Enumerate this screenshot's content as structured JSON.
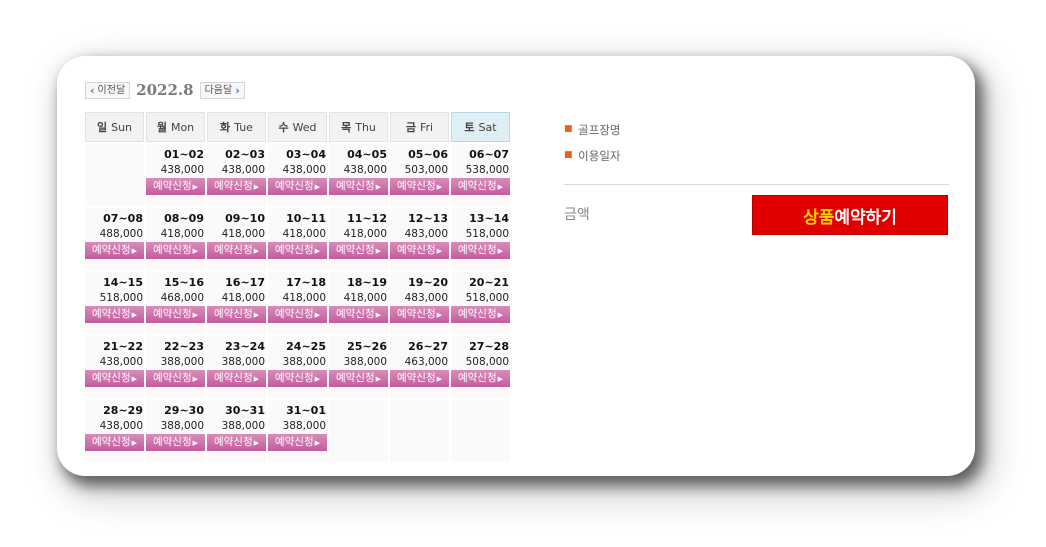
{
  "nav": {
    "prev_label": "이전달",
    "next_label": "다음달",
    "current_month": "2022.8"
  },
  "weekdays": [
    {
      "ko": "일",
      "en": "Sun"
    },
    {
      "ko": "월",
      "en": "Mon"
    },
    {
      "ko": "화",
      "en": "Tue"
    },
    {
      "ko": "수",
      "en": "Wed"
    },
    {
      "ko": "목",
      "en": "Thu"
    },
    {
      "ko": "금",
      "en": "Fri"
    },
    {
      "ko": "토",
      "en": "Sat"
    }
  ],
  "reserve_label": "예약신청",
  "weeks": [
    [
      null,
      {
        "dates": "01~02",
        "price": "438,000"
      },
      {
        "dates": "02~03",
        "price": "438,000"
      },
      {
        "dates": "03~04",
        "price": "438,000"
      },
      {
        "dates": "04~05",
        "price": "438,000"
      },
      {
        "dates": "05~06",
        "price": "503,000"
      },
      {
        "dates": "06~07",
        "price": "538,000"
      }
    ],
    [
      {
        "dates": "07~08",
        "price": "488,000"
      },
      {
        "dates": "08~09",
        "price": "418,000"
      },
      {
        "dates": "09~10",
        "price": "418,000"
      },
      {
        "dates": "10~11",
        "price": "418,000"
      },
      {
        "dates": "11~12",
        "price": "418,000"
      },
      {
        "dates": "12~13",
        "price": "483,000"
      },
      {
        "dates": "13~14",
        "price": "518,000"
      }
    ],
    [
      {
        "dates": "14~15",
        "price": "518,000"
      },
      {
        "dates": "15~16",
        "price": "468,000"
      },
      {
        "dates": "16~17",
        "price": "418,000"
      },
      {
        "dates": "17~18",
        "price": "418,000"
      },
      {
        "dates": "18~19",
        "price": "418,000"
      },
      {
        "dates": "19~20",
        "price": "483,000"
      },
      {
        "dates": "20~21",
        "price": "518,000"
      }
    ],
    [
      {
        "dates": "21~22",
        "price": "438,000"
      },
      {
        "dates": "22~23",
        "price": "388,000"
      },
      {
        "dates": "23~24",
        "price": "388,000"
      },
      {
        "dates": "24~25",
        "price": "388,000"
      },
      {
        "dates": "25~26",
        "price": "388,000"
      },
      {
        "dates": "26~27",
        "price": "463,000"
      },
      {
        "dates": "27~28",
        "price": "508,000"
      }
    ],
    [
      {
        "dates": "28~29",
        "price": "438,000"
      },
      {
        "dates": "29~30",
        "price": "388,000"
      },
      {
        "dates": "30~31",
        "price": "388,000"
      },
      {
        "dates": "31~01",
        "price": "388,000"
      },
      null,
      null,
      null
    ]
  ],
  "info": {
    "golf_course_label": "골프장명",
    "use_date_label": "이용일자",
    "amount_label": "금액"
  },
  "book_button": {
    "highlight": "상품",
    "rest": "예약하기"
  },
  "colors": {
    "book_button_bg": "#e10000",
    "book_button_highlight": "#ffd400",
    "reserve_button": "#c45c9c",
    "saturday_header": "#deeff5",
    "bullet": "#e8621b"
  }
}
